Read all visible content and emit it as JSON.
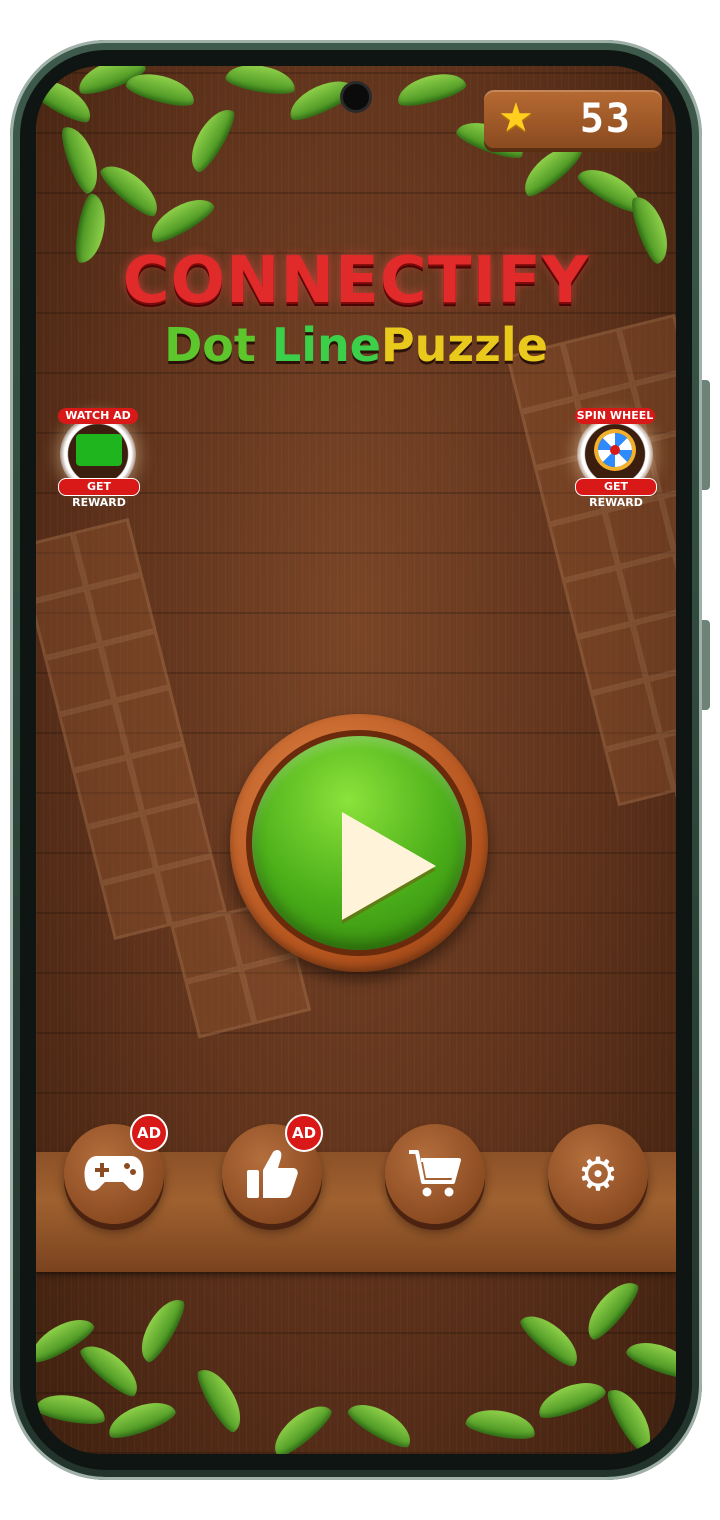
{
  "header": {
    "star_icon": "star-icon",
    "star_count": "53"
  },
  "title": {
    "line1": "CONNECTIFY",
    "line2_dot": "Dot",
    "line2_line": "Line",
    "line2_puzzle": "Puzzle"
  },
  "rewards": {
    "watch_ad": {
      "top": "WATCH AD",
      "bottom": "GET REWARD",
      "icon": "video-ad-icon"
    },
    "spin_wheel": {
      "top": "SPIN WHEEL",
      "bottom": "GET REWARD",
      "icon": "wheel-icon"
    }
  },
  "play": {
    "icon": "play-icon"
  },
  "bottom_nav": {
    "games": {
      "icon": "gamepad-icon",
      "badge": "AD"
    },
    "like": {
      "icon": "thumbs-up-icon",
      "badge": "AD"
    },
    "shop": {
      "icon": "cart-icon"
    },
    "settings": {
      "icon": "gear-icon"
    }
  },
  "colors": {
    "title_red": "#e12a2a",
    "puzzle_yellow": "#e8c91c",
    "play_green": "#4aad19",
    "badge_red": "#d91818"
  }
}
